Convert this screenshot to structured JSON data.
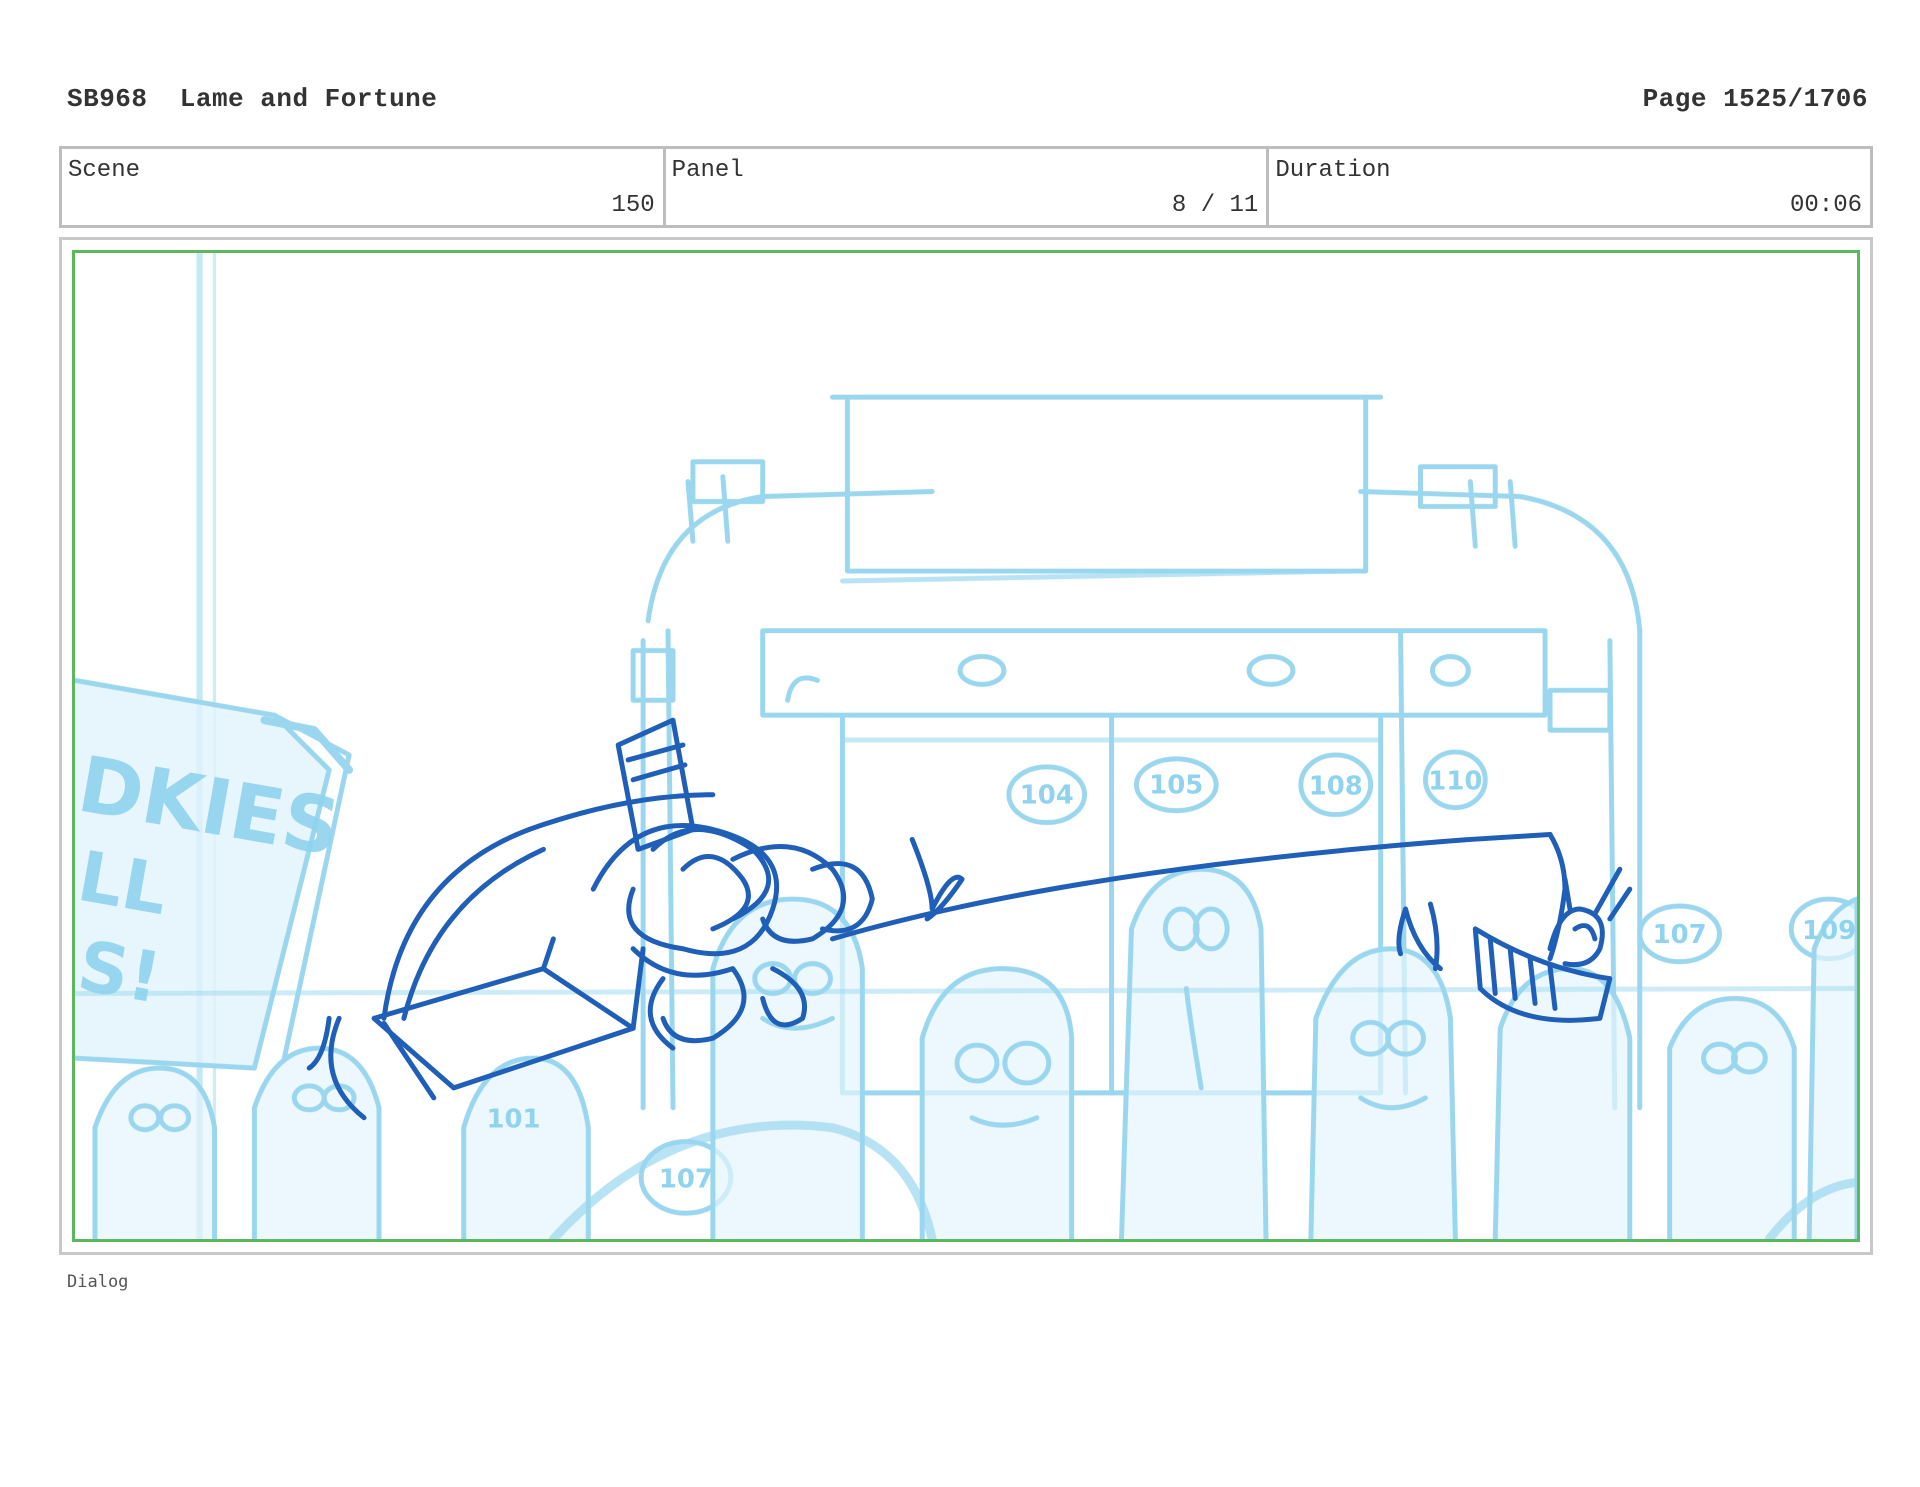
{
  "header": {
    "episode_code": "SB968",
    "episode_title": "Lame and Fortune",
    "page_label": "Page 1525/1706"
  },
  "info": {
    "scene_label": "Scene",
    "scene_value": "150",
    "panel_label": "Panel",
    "panel_value": "8 / 11",
    "duration_label": "Duration",
    "duration_value": "00:06"
  },
  "drawing": {
    "sketch_text": {
      "sign_letters_1": "DKIES",
      "sign_letters_2": "LL",
      "sign_letters_3": "S!",
      "badges": [
        "104",
        "105",
        "108",
        "110",
        "107",
        "107",
        "109",
        "101"
      ]
    },
    "colors": {
      "background_sketch": "#8fd3ee",
      "background_fill": "#dff3fb",
      "foreground_sketch": "#1f5fb8",
      "frame_green": "#5cb85c"
    }
  },
  "footer": {
    "dialog_label": "Dialog"
  }
}
